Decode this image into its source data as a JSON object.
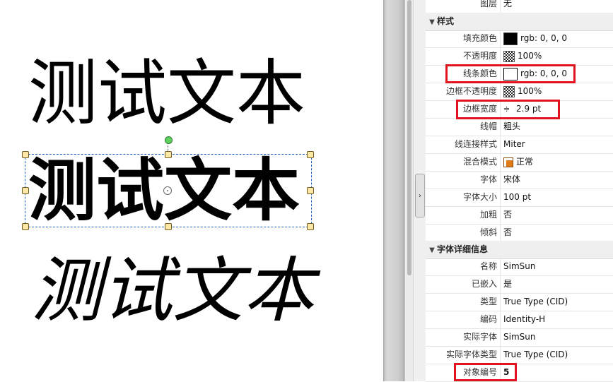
{
  "canvas": {
    "samples": {
      "regular": "测试文本",
      "bold": "测试文本",
      "italic": "测试文本"
    }
  },
  "properties": {
    "top_row": {
      "label": "图层",
      "value": "无"
    },
    "style_section": {
      "title": "样式",
      "rows": [
        {
          "label": "填充颜色",
          "value": "rgb: 0, 0, 0",
          "swatch": "#000000"
        },
        {
          "label": "不透明度",
          "value": "100%"
        },
        {
          "label": "线条颜色",
          "value": "rgb: 0, 0, 0",
          "swatch": "#ffffff"
        },
        {
          "label": "边框不透明度",
          "value": "100%"
        },
        {
          "label": "边框宽度",
          "value": "2.9 pt"
        },
        {
          "label": "线帽",
          "value": "粗头"
        },
        {
          "label": "线连接样式",
          "value": "Miter"
        },
        {
          "label": "混合模式",
          "value": "正常"
        },
        {
          "label": "字体",
          "value": "宋体"
        },
        {
          "label": "字体大小",
          "value": "100 pt"
        },
        {
          "label": "加粗",
          "value": "否"
        },
        {
          "label": "倾斜",
          "value": "否"
        }
      ]
    },
    "font_section": {
      "title": "字体详细信息",
      "rows": [
        {
          "label": "名称",
          "value": "SimSun"
        },
        {
          "label": "已嵌入",
          "value": "是"
        },
        {
          "label": "类型",
          "value": "True Type (CID)"
        },
        {
          "label": "编码",
          "value": "Identity-H"
        },
        {
          "label": "实际字体",
          "value": "SimSun"
        },
        {
          "label": "实际字体类型",
          "value": "True Type (CID)"
        },
        {
          "label": "对象编号",
          "value": "5"
        }
      ]
    }
  },
  "colors": {
    "highlight": "#e0141e",
    "selection": "#1f5fbf"
  }
}
